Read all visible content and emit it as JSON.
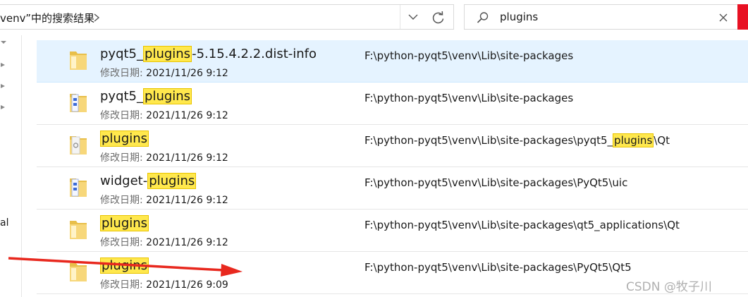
{
  "address_bar": {
    "text": "venv”中的搜索结果"
  },
  "search": {
    "query": "plugins"
  },
  "navpane": {
    "cut_text": "al"
  },
  "results": [
    {
      "name_parts": [
        {
          "t": "pyqt5_",
          "hl": false
        },
        {
          "t": "plugins",
          "hl": true
        },
        {
          "t": "-5.15.4.2.2.dist-info",
          "hl": false
        }
      ],
      "meta_label": "修改日期:",
      "date": "2021/11/26 9:12",
      "path_parts": [
        {
          "t": "F:\\python-pyqt5\\venv\\Lib\\site-packages",
          "hl": false
        }
      ],
      "folder": "plain",
      "selected": true
    },
    {
      "name_parts": [
        {
          "t": "pyqt5_",
          "hl": false
        },
        {
          "t": "plugins",
          "hl": true
        }
      ],
      "meta_label": "修改日期:",
      "date": "2021/11/26 9:12",
      "path_parts": [
        {
          "t": "F:\\python-pyqt5\\venv\\Lib\\site-packages",
          "hl": false
        }
      ],
      "folder": "files",
      "selected": false
    },
    {
      "name_parts": [
        {
          "t": "plugins",
          "hl": true
        }
      ],
      "meta_label": "修改日期:",
      "date": "2021/11/26 9:12",
      "path_parts": [
        {
          "t": "F:\\python-pyqt5\\venv\\Lib\\site-packages\\pyqt5_",
          "hl": false
        },
        {
          "t": "plugins",
          "hl": true
        },
        {
          "t": "\\Qt",
          "hl": false
        }
      ],
      "folder": "gear",
      "selected": false
    },
    {
      "name_parts": [
        {
          "t": "widget-",
          "hl": false
        },
        {
          "t": "plugins",
          "hl": true
        }
      ],
      "meta_label": "修改日期:",
      "date": "2021/11/26 9:12",
      "path_parts": [
        {
          "t": "F:\\python-pyqt5\\venv\\Lib\\site-packages\\PyQt5\\uic",
          "hl": false
        }
      ],
      "folder": "files",
      "selected": false
    },
    {
      "name_parts": [
        {
          "t": "plugins",
          "hl": true
        }
      ],
      "meta_label": "修改日期:",
      "date": "2021/11/26 9:12",
      "path_parts": [
        {
          "t": "F:\\python-pyqt5\\venv\\Lib\\site-packages\\qt5_applications\\Qt",
          "hl": false
        }
      ],
      "folder": "plain",
      "selected": false
    },
    {
      "name_parts": [
        {
          "t": "plugins",
          "hl": true
        }
      ],
      "meta_label": "修改日期:",
      "date": "2021/11/26 9:09",
      "path_parts": [
        {
          "t": "F:\\python-pyqt5\\venv\\Lib\\site-packages\\PyQt5\\Qt5",
          "hl": false
        }
      ],
      "folder": "plain",
      "selected": false
    }
  ],
  "watermark": "CSDN @牧子川",
  "colors": {
    "highlight": "#ffe84d",
    "selection": "#e5f3ff",
    "close_red": "#e81123",
    "annotation_arrow": "#e8281e"
  }
}
